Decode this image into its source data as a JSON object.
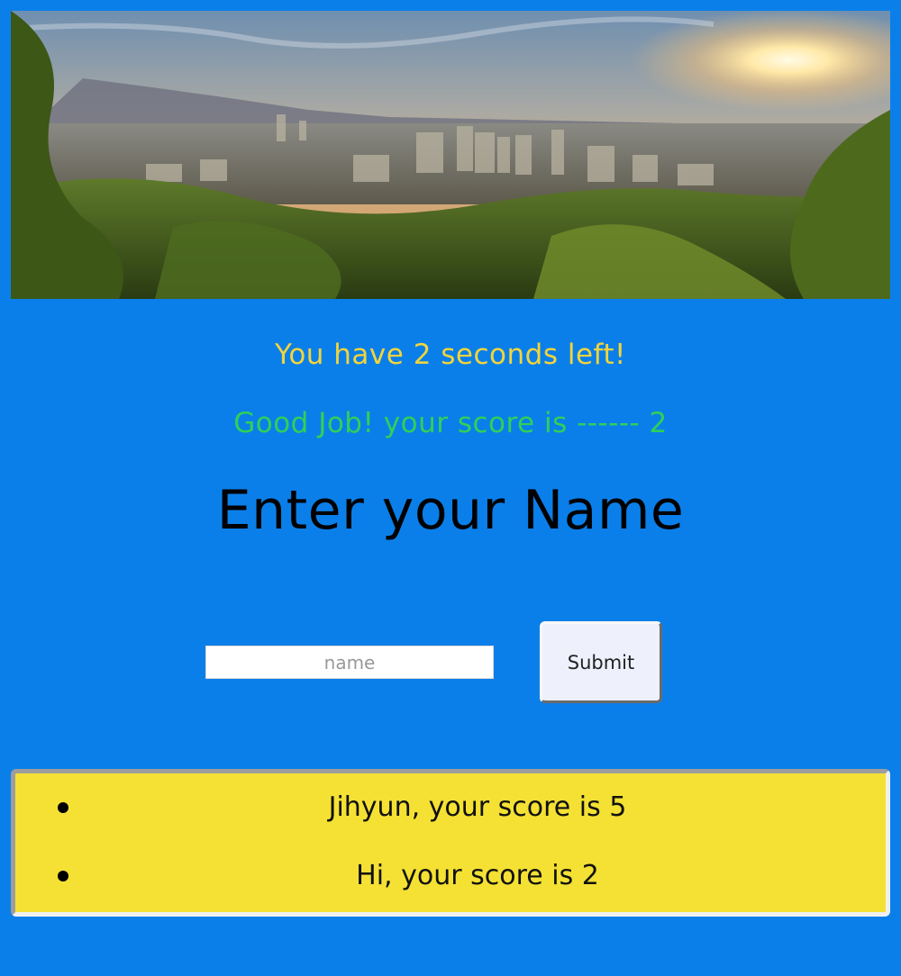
{
  "hero": {
    "icon": "city-sunset-photo"
  },
  "timer_text": "You have 2 seconds left!",
  "score_text": "Good Job! your score is ------ 2",
  "heading": "Enter your Name",
  "form": {
    "name_placeholder": "name",
    "name_value": "",
    "submit_label": "Submit"
  },
  "scoreboard": {
    "entries": [
      "Jihyun, your score is 5",
      "Hi, your score is 2"
    ]
  },
  "colors": {
    "background": "#0b7fe9",
    "timer": "#f2d43b",
    "score": "#2ed158",
    "scoreboard_bg": "#f4e133"
  }
}
